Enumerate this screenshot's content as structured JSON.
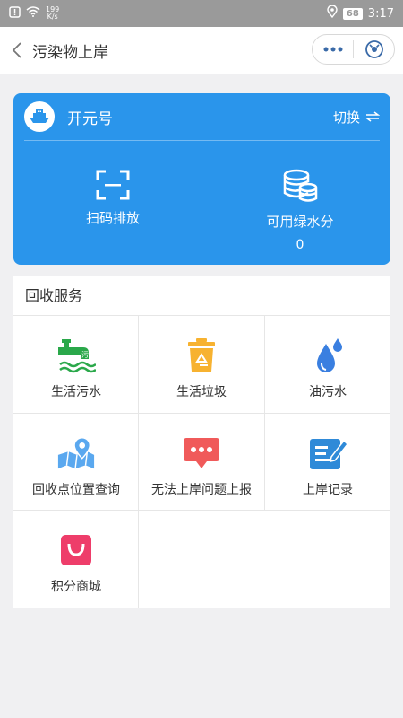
{
  "status_bar": {
    "net_speed": "199",
    "net_unit": "K/s",
    "battery": "68",
    "time": "3:17"
  },
  "nav": {
    "title": "污染物上岸"
  },
  "card": {
    "ship_name": "开元号",
    "switch_label": "切换",
    "scan_label": "扫码排放",
    "green_points_label": "可用绿水分",
    "green_points_value": "0"
  },
  "services": {
    "title": "回收服务",
    "items": [
      {
        "label": "生活污水",
        "icon": "sewage-icon"
      },
      {
        "label": "生活垃圾",
        "icon": "recycle-bin-icon"
      },
      {
        "label": "油污水",
        "icon": "oil-drop-icon"
      },
      {
        "label": "回收点位置查询",
        "icon": "map-pin-icon"
      },
      {
        "label": "无法上岸问题上报",
        "icon": "chat-bubble-icon"
      },
      {
        "label": "上岸记录",
        "icon": "record-edit-icon"
      },
      {
        "label": "积分商城",
        "icon": "shopping-bag-icon"
      }
    ]
  },
  "colors": {
    "primary": "#2a95eb",
    "sewage_green": "#2aa84a",
    "trash_orange": "#f7b230",
    "oil_blue": "#3a7fe0",
    "pin_blue": "#5aa8ef",
    "chat_red": "#f05a5a",
    "record_blue": "#2f8ad8",
    "bag_pink": "#ee3d6a"
  }
}
